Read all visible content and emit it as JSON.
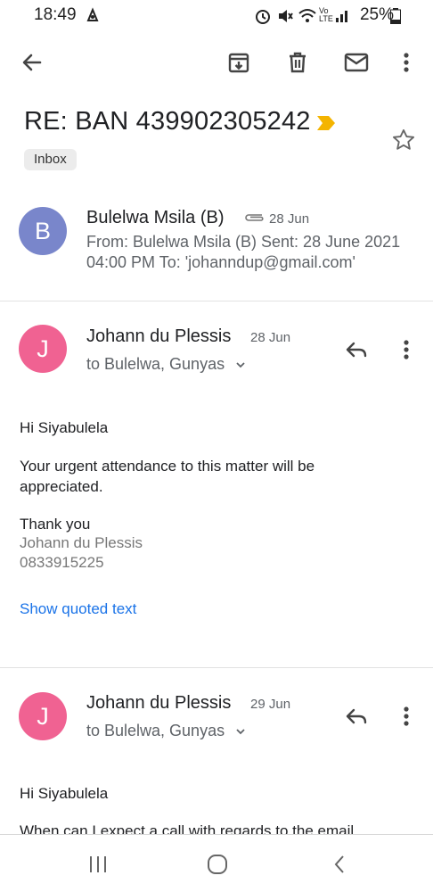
{
  "status_bar": {
    "time": "18:49",
    "battery": "25%"
  },
  "thread": {
    "subject": "RE: BAN 439902305242",
    "label": "Inbox"
  },
  "collapsed_message": {
    "avatar_letter": "B",
    "sender": "Bulelwa Msila (B)",
    "date": "28 Jun",
    "snippet_line1": "From: Bulelwa Msila (B) Sent: 28 June 2021",
    "snippet_line2": "04:00 PM To: 'johanndup@gmail.com'",
    "avatar_color": "#7986cb"
  },
  "message1": {
    "avatar_letter": "J",
    "sender": "Johann du Plessis",
    "date": "28 Jun",
    "recipients": "to Bulelwa, Gunyas",
    "greeting": "Hi Siyabulela",
    "body_line1": "Your urgent attendance to this matter will be",
    "body_line2": "appreciated.",
    "closing": "Thank you",
    "sig_name": "Johann du Plessis",
    "sig_phone": "0833915225",
    "show_quoted": "Show quoted text",
    "avatar_color": "#f06292"
  },
  "message2": {
    "avatar_letter": "J",
    "sender": "Johann du Plessis",
    "date": "29 Jun",
    "recipients": "to Bulelwa, Gunyas",
    "greeting": "Hi Siyabulela",
    "body_line1": "When can I expect a call with regards to the email",
    "avatar_color": "#f06292"
  },
  "colors": {
    "important_marker": "#f4b400",
    "link": "#1a73e8"
  }
}
